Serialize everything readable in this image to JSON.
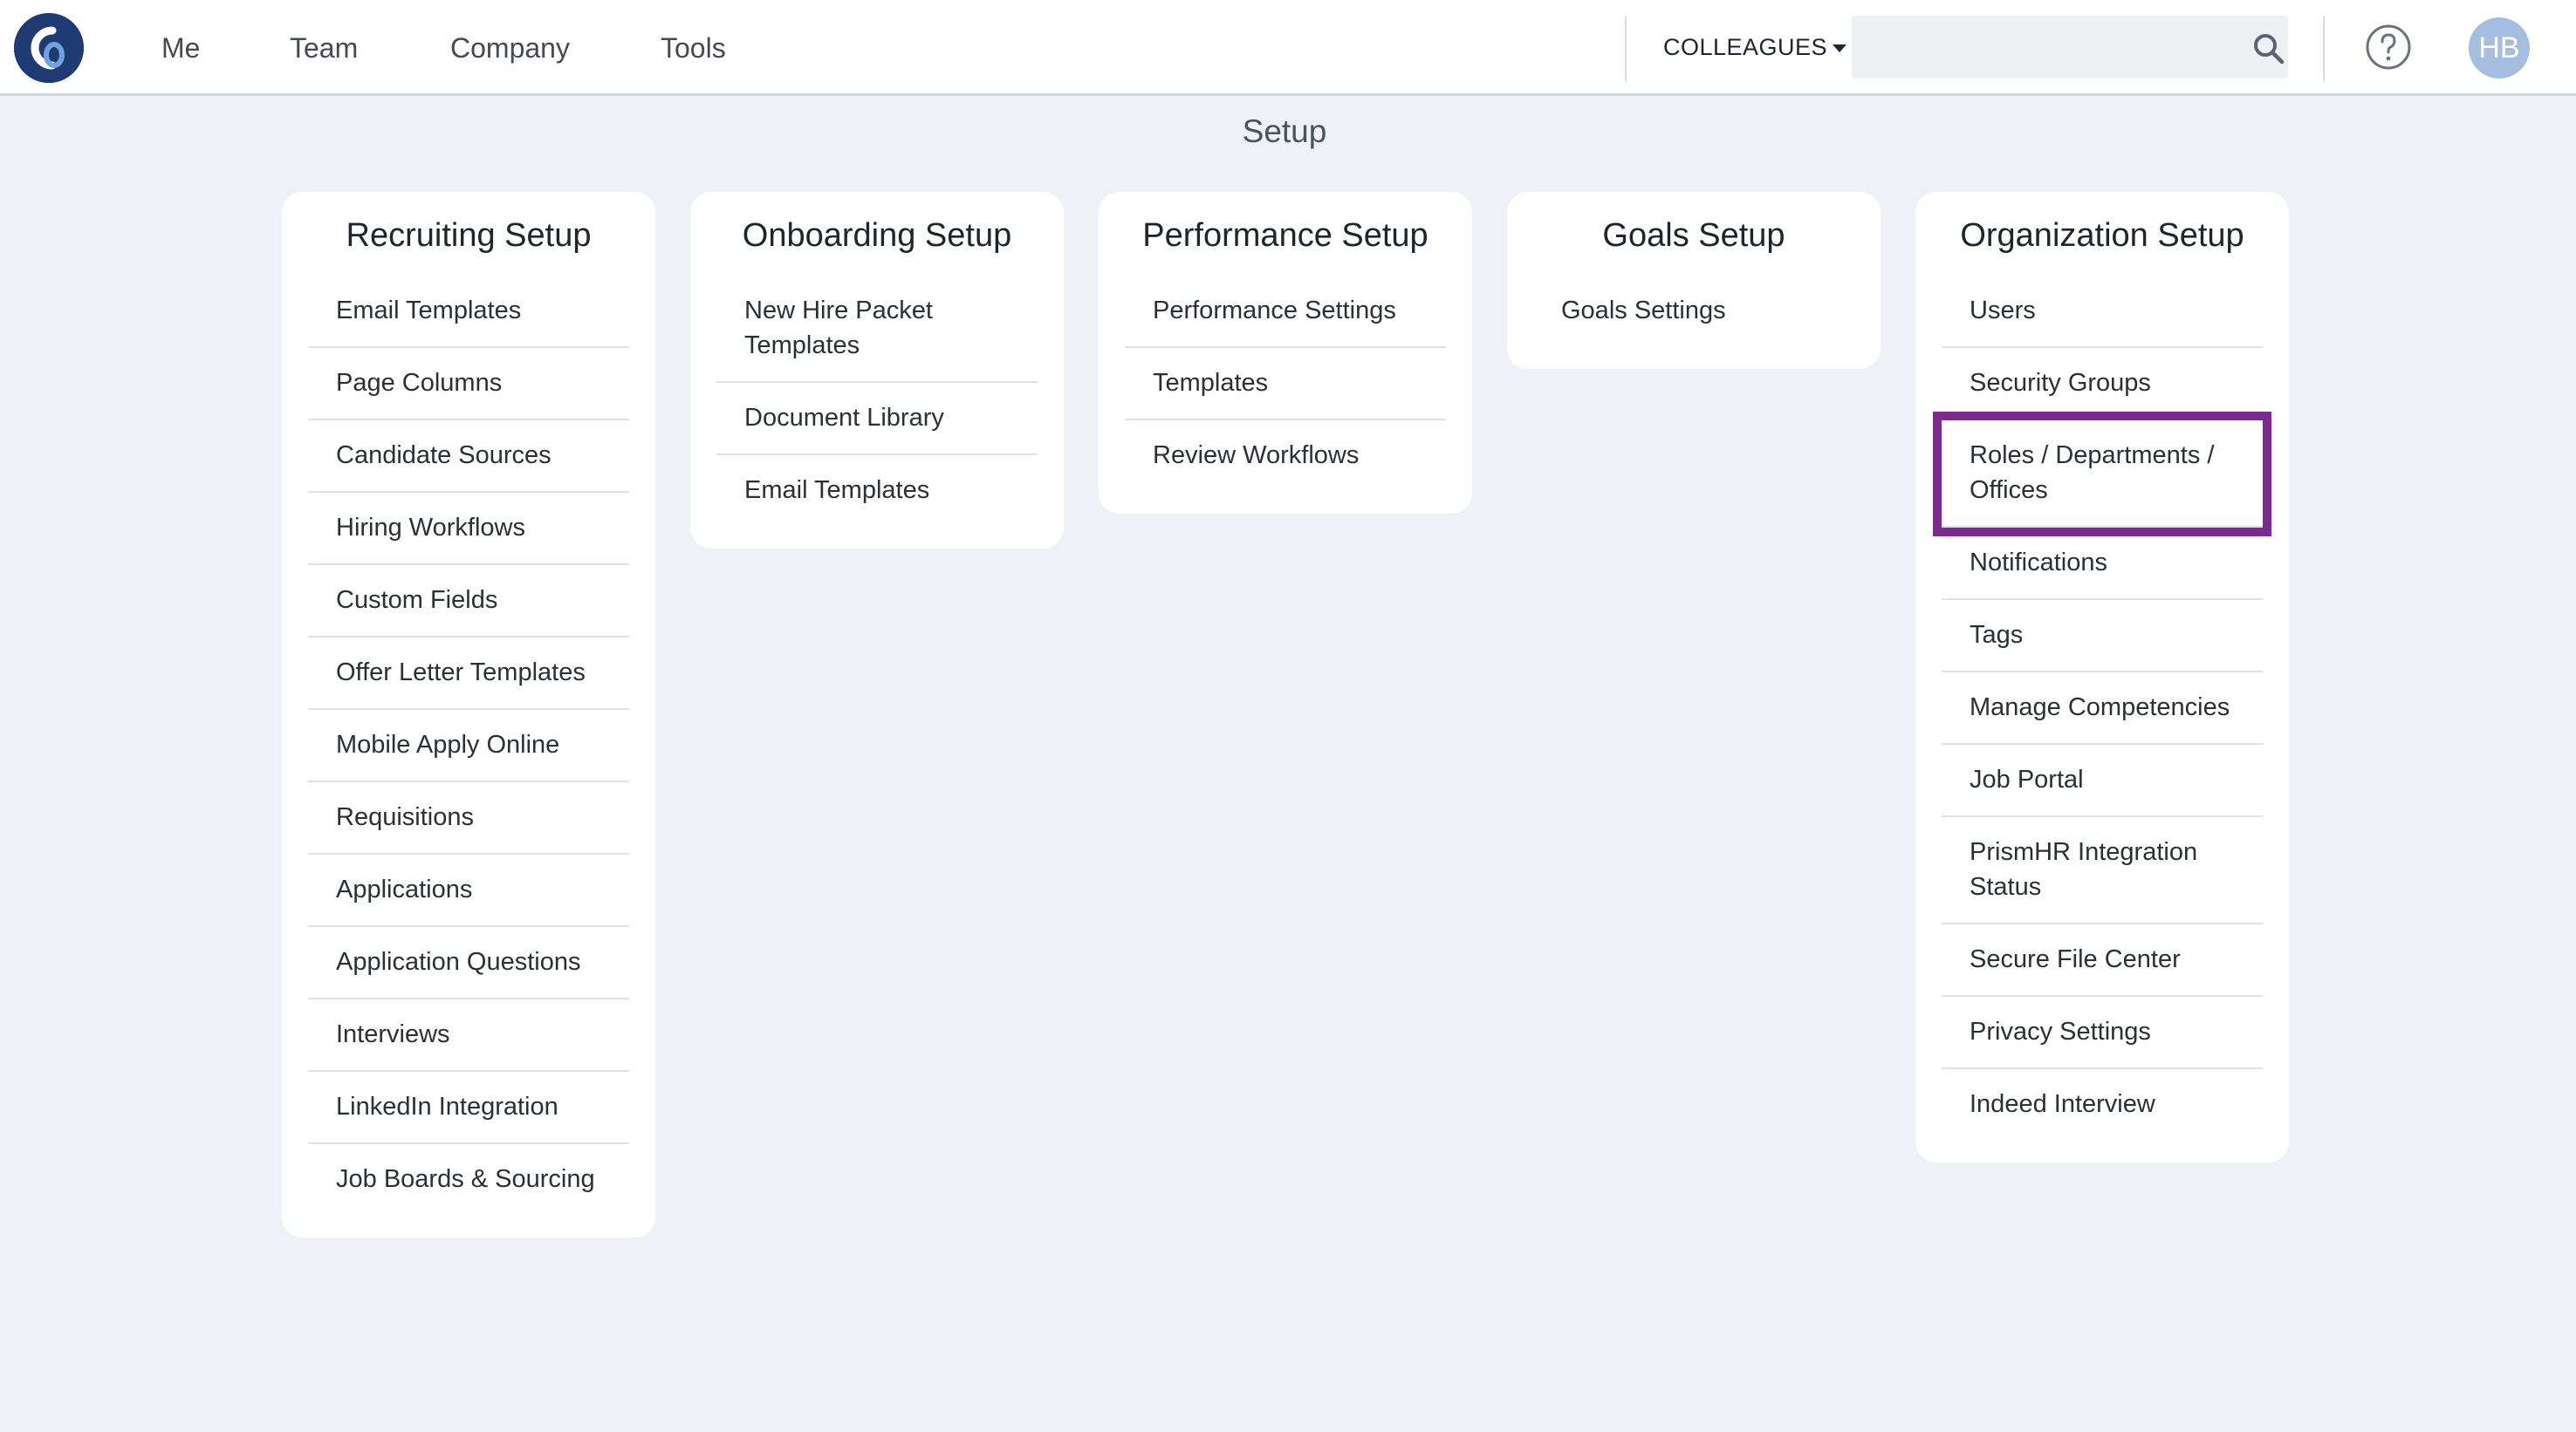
{
  "nav": {
    "items": [
      "Me",
      "Team",
      "Company",
      "Tools"
    ],
    "colleagues_label": "COLLEAGUES",
    "search_placeholder": "",
    "avatar_initials": "HB"
  },
  "page": {
    "title": "Setup"
  },
  "cards": [
    {
      "title": "Recruiting Setup",
      "items": [
        "Email Templates",
        "Page Columns",
        "Candidate Sources",
        "Hiring Workflows",
        "Custom Fields",
        "Offer Letter Templates",
        "Mobile Apply Online",
        "Requisitions",
        "Applications",
        "Application Questions",
        "Interviews",
        "LinkedIn Integration",
        "Job Boards & Sourcing"
      ]
    },
    {
      "title": "Onboarding Setup",
      "items": [
        "New Hire Packet Templates",
        "Document Library",
        "Email Templates"
      ]
    },
    {
      "title": "Performance Setup",
      "items": [
        "Performance Settings",
        "Templates",
        "Review Workflows"
      ]
    },
    {
      "title": "Goals Setup",
      "items": [
        "Goals Settings"
      ]
    },
    {
      "title": "Organization Setup",
      "items": [
        "Users",
        "Security Groups",
        "Roles / Departments / Offices",
        "Notifications",
        "Tags",
        "Manage Competencies",
        "Job Portal",
        "PrismHR Integration Status",
        "Secure File Center",
        "Privacy Settings",
        "Indeed Interview"
      ]
    }
  ],
  "highlighted_item": "Roles / Departments / Offices",
  "colors": {
    "brand": "#1f3b73",
    "highlight": "#7b2a8f",
    "background": "#eef2f6"
  },
  "icons": [
    "logo-icon",
    "search-icon",
    "help-icon",
    "chevron-down-icon"
  ]
}
